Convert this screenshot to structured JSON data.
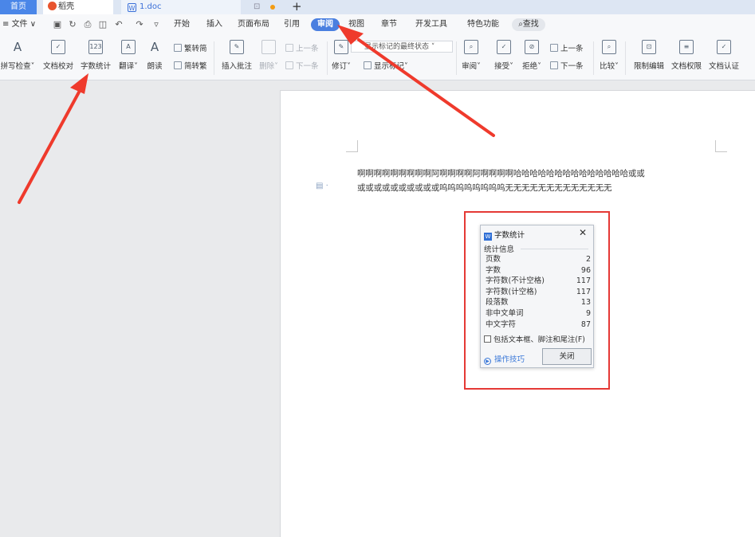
{
  "tabs": {
    "home": "首页",
    "daoke": "稻壳",
    "doc": "1.doc"
  },
  "menu": {
    "file": "文件",
    "items": [
      "开始",
      "插入",
      "页面布局",
      "引用",
      "审阅",
      "视图",
      "章节",
      "开发工具",
      "特色功能"
    ],
    "search": "查找"
  },
  "ribbon": {
    "spell": "拼写检查",
    "proofread": "文档校对",
    "wordcount": "字数统计",
    "translate": "翻译",
    "readaloud": "朗读",
    "trad": "繁转简",
    "simp": "简转繁",
    "insert_comment": "插入批注",
    "delete": "删除",
    "prev_comment": "上一条",
    "next_comment": "下一条",
    "track": "修订",
    "markup_state": "显示标记的最终状态",
    "show_markup": "显示标记",
    "review": "审阅",
    "accept": "接受",
    "reject": "拒绝",
    "prev": "上一条",
    "next": "下一条",
    "compare": "比较",
    "restrict": "限制编辑",
    "permission": "文档权限",
    "certify": "文档认证"
  },
  "document": {
    "line1": "啊啊啊啊啊啊啊啊啊阿啊啊啊啊阿啊啊啊啊哈哈哈哈哈哈哈哈哈哈哈哈哈哈或或",
    "line2": "或或或或或或或或或或呜呜呜呜呜呜呜呜无无无无无无无无无无无无无"
  },
  "dialog": {
    "title": "字数统计",
    "section": "统计信息",
    "stats": [
      {
        "label": "页数",
        "value": "2"
      },
      {
        "label": "字数",
        "value": "96"
      },
      {
        "label": "字符数(不计空格)",
        "value": "117"
      },
      {
        "label": "字符数(计空格)",
        "value": "117"
      },
      {
        "label": "段落数",
        "value": "13"
      },
      {
        "label": "非中文单词",
        "value": "9"
      },
      {
        "label": "中文字符",
        "value": "87"
      }
    ],
    "checkbox": "包括文本框、脚注和尾注(F)",
    "tips": "操作技巧",
    "close": "关闭"
  },
  "colors": {
    "accent": "#4a7fe0",
    "highlight": "#e53935"
  }
}
